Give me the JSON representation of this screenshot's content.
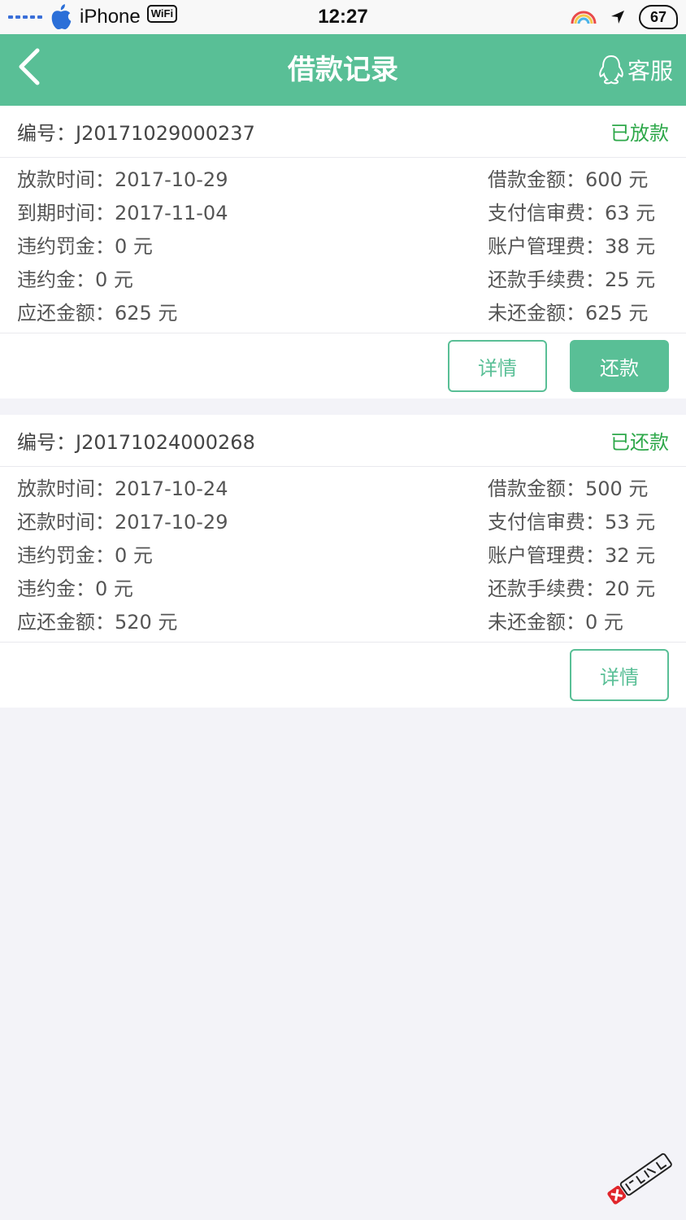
{
  "status_bar": {
    "carrier": "iPhone",
    "wifi_label": "WiFi",
    "time": "12:27",
    "battery": "67"
  },
  "nav": {
    "title": "借款记录",
    "service_label": "客服"
  },
  "records": [
    {
      "order_label": "编号：J20171029000237",
      "status": "已放款",
      "rows": [
        [
          "放款时间：2017-10-29",
          "借款金额：600 元"
        ],
        [
          "到期时间：2017-11-04",
          "支付信审费：63 元"
        ],
        [
          "违约罚金：0 元",
          "账户管理费：38 元"
        ],
        [
          "违约金：0 元",
          "还款手续费：25 元"
        ],
        [
          "应还金额：625 元",
          "未还金额：625 元"
        ]
      ],
      "buttons": {
        "detail": "详情",
        "repay": "还款"
      }
    },
    {
      "order_label": "编号：J20171024000268",
      "status": "已还款",
      "rows": [
        [
          "放款时间：2017-10-24",
          "借款金额：500 元"
        ],
        [
          "还款时间：2017-10-29",
          "支付信审费：53 元"
        ],
        [
          "违约罚金：0 元",
          "账户管理费：32 元"
        ],
        [
          "违约金：0 元",
          "还款手续费：20 元"
        ],
        [
          "应还金额：520 元",
          "未还金额：0 元"
        ]
      ],
      "buttons": {
        "detail": "详情"
      }
    }
  ],
  "colors": {
    "accent": "#59bf96",
    "status_text": "#2ea84a",
    "background": "#f3f3f8"
  },
  "icons": {
    "back": "chevron-left-icon",
    "service": "qq-penguin-icon",
    "location": "location-arrow-icon",
    "rainbow": "rainbow-icon",
    "watermark": "kanong-logo"
  }
}
